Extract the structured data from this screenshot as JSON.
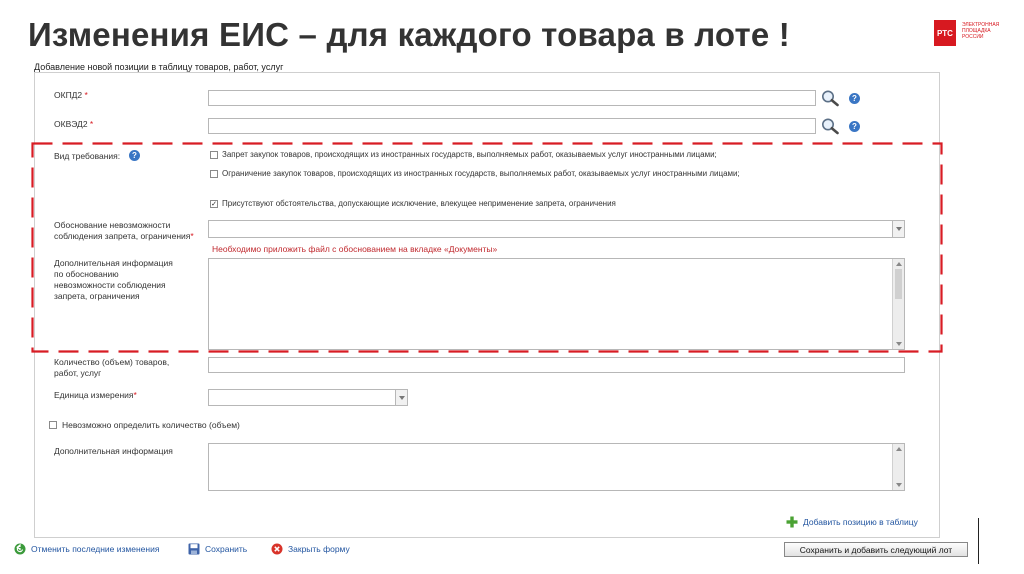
{
  "slide": {
    "title": "Изменения ЕИС – для каждого товара в лоте !",
    "logo_short": "РТС",
    "logo_text": "ЭЛЕКТРОННАЯ ПЛОЩАДКА РОССИИ"
  },
  "form": {
    "heading": "Добавление новой позиции в таблицу товаров, работ, услуг",
    "okpd2": {
      "label": "ОКПД2",
      "value": ""
    },
    "okved2": {
      "label": "ОКВЭД2",
      "value": ""
    },
    "required_mark": "*",
    "requirement_type": {
      "label": "Вид требования:",
      "options": [
        {
          "label": "Запрет закупок товаров, происходящих из иностранных государств, выполняемых работ, оказываемых услуг иностранными лицами;",
          "checked": false
        },
        {
          "label": "Ограничение закупок товаров, происходящих из иностранных государств, выполняемых работ, оказываемых услуг иностранными лицами;",
          "checked": false
        },
        {
          "label": "Присутствуют обстоятельства, допускающие исключение, влекущее неприменение запрета, ограничения",
          "checked": true
        }
      ]
    },
    "justification": {
      "label_line1": "Обоснование невозможности",
      "label_line2": "соблюдения запрета, ограничения",
      "value": "",
      "warning": "Необходимо приложить файл с обоснованием на вкладке «Документы»"
    },
    "additional_justification": {
      "label_line1": "Дополнительная информация",
      "label_line2": "по обоснованию",
      "label_line3": "невозможности соблюдения",
      "label_line4": "запрета, ограничения",
      "value": ""
    },
    "quantity": {
      "label_line1": "Количество (объем) товаров,",
      "label_line2": "работ, услуг",
      "value": ""
    },
    "unit": {
      "label": "Единица измерения",
      "value": ""
    },
    "cannot_determine": {
      "label": "Невозможно определить количество (объем)",
      "checked": false
    },
    "additional_info": {
      "label": "Дополнительная информация",
      "value": ""
    },
    "add_position_label": "Добавить позицию в таблицу"
  },
  "footer": {
    "undo_label": "Отменить последние изменения",
    "save_label": "Сохранить",
    "close_label": "Закрыть форму",
    "save_next_label": "Сохранить и добавить следующий лот"
  },
  "colors": {
    "accent_red": "#d71920",
    "link_blue": "#2255a0",
    "dash_red": "#d81c24"
  }
}
